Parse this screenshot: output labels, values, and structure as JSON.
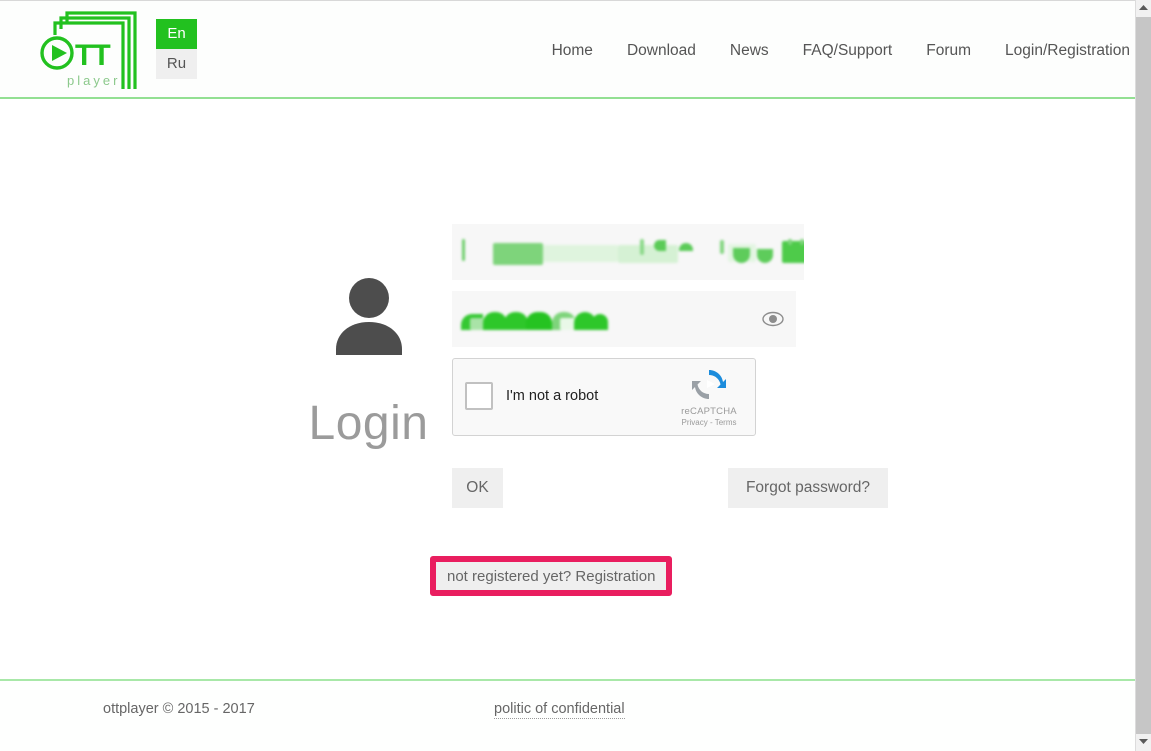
{
  "header": {
    "logo": {
      "name": "ottplayer-logo",
      "primary_text": "OTT",
      "secondary_text": "player",
      "color": "#22c11f"
    },
    "language": {
      "active": "En",
      "inactive": "Ru",
      "active_bg": "#22c11f",
      "inactive_bg": "#efefef"
    },
    "nav": [
      {
        "label": "Home",
        "name": "nav-home"
      },
      {
        "label": "Download",
        "name": "nav-download"
      },
      {
        "label": "News",
        "name": "nav-news"
      },
      {
        "label": "FAQ/Support",
        "name": "nav-faq-support"
      },
      {
        "label": "Forum",
        "name": "nav-forum"
      },
      {
        "label": "Login/Registration",
        "name": "nav-login-registration"
      }
    ]
  },
  "login": {
    "title": "Login",
    "avatar_icon": "user-avatar-icon",
    "email_field": {
      "name": "email-input",
      "value": "",
      "placeholder": "",
      "redacted": true,
      "redaction_color": "#4ecb4a"
    },
    "password_field": {
      "name": "password-input",
      "value": "",
      "placeholder": "",
      "redacted": true,
      "redaction_color": "#2ec72a",
      "reveal_icon": "eye-icon"
    },
    "recaptcha": {
      "checkbox_label": "I'm not a robot",
      "brand_name": "reCAPTCHA",
      "links_text": "Privacy - Terms",
      "checked": false,
      "logo_icon": "recaptcha-logo-icon"
    },
    "buttons": {
      "ok": "OK",
      "forgot_password": "Forgot password?",
      "register": "not registered yet? Registration",
      "register_highlight_color": "#e91e5f"
    }
  },
  "footer": {
    "copyright": "ottplayer © 2015 - 2017",
    "privacy_link": "politic of confidential"
  },
  "scrollbar": {
    "up_icon": "chevron-up-icon",
    "down_icon": "chevron-down-icon",
    "thumb_color": "#c6c6c6"
  }
}
